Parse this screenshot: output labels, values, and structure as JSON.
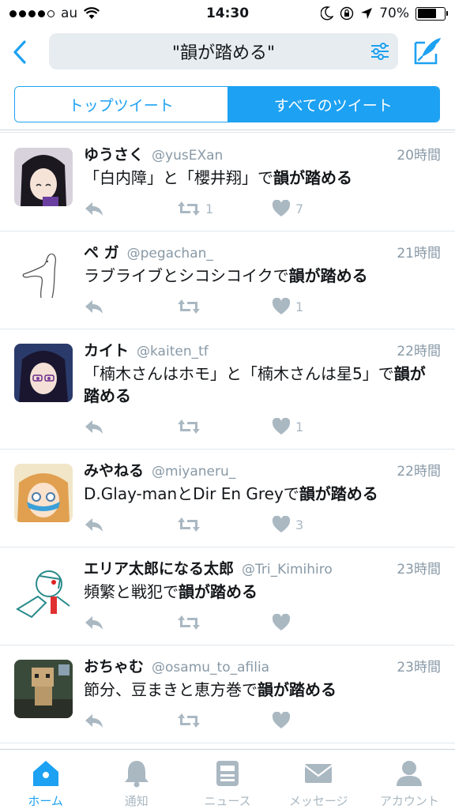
{
  "status_bar": {
    "carrier": "au",
    "time": "14:30",
    "battery": "70%",
    "battery_level": 0.7
  },
  "search": {
    "query": "\"韻が踏める\""
  },
  "tabs": [
    {
      "label": "トップツイート",
      "active": false
    },
    {
      "label": "すべてのツイート",
      "active": true
    }
  ],
  "tweets": [
    {
      "name": "ゆうさく",
      "handle": "@yusEXan",
      "time": "20時間",
      "text_plain": "「白内障」と「櫻井翔」で",
      "text_bold": "韻が踏める",
      "retweets": "1",
      "likes": "7"
    },
    {
      "name": "ペ ガ",
      "handle": "@pegachan_",
      "time": "21時間",
      "text_plain": "ラブライブとシコシコイクで",
      "text_bold": "韻が踏める",
      "retweets": "",
      "likes": "1"
    },
    {
      "name": "カイト",
      "handle": "@kaiten_tf",
      "time": "22時間",
      "text_plain": "「楠木さんはホモ」と「楠木さんは星5」で",
      "text_bold": "韻が踏める",
      "retweets": "",
      "likes": "1"
    },
    {
      "name": "みやねる",
      "handle": "@miyaneru_",
      "time": "22時間",
      "text_plain": "D.Glay-manとDir En Greyで",
      "text_bold": "韻が踏める",
      "retweets": "",
      "likes": "3"
    },
    {
      "name": "エリア太郎になる太郎",
      "handle": "@Tri_Kimihiro",
      "time": "23時間",
      "text_plain": "頻繁と戦犯で",
      "text_bold": "韻が踏める",
      "retweets": "",
      "likes": ""
    },
    {
      "name": "おちゃむ",
      "handle": "@osamu_to_afilia",
      "time": "23時間",
      "text_plain": "節分、豆まきと恵方巻で",
      "text_bold": "韻が踏める",
      "retweets": "",
      "likes": ""
    }
  ],
  "tabbar": [
    {
      "label": "ホーム",
      "icon": "home-icon",
      "active": true
    },
    {
      "label": "通知",
      "icon": "bell-icon",
      "active": false
    },
    {
      "label": "ニュース",
      "icon": "news-icon",
      "active": false
    },
    {
      "label": "メッセージ",
      "icon": "envelope-icon",
      "active": false
    },
    {
      "label": "アカウント",
      "icon": "person-icon",
      "active": false
    }
  ],
  "colors": {
    "accent": "#1da1f2",
    "muted": "#8899a6",
    "icon_gray": "#aab8c2"
  }
}
